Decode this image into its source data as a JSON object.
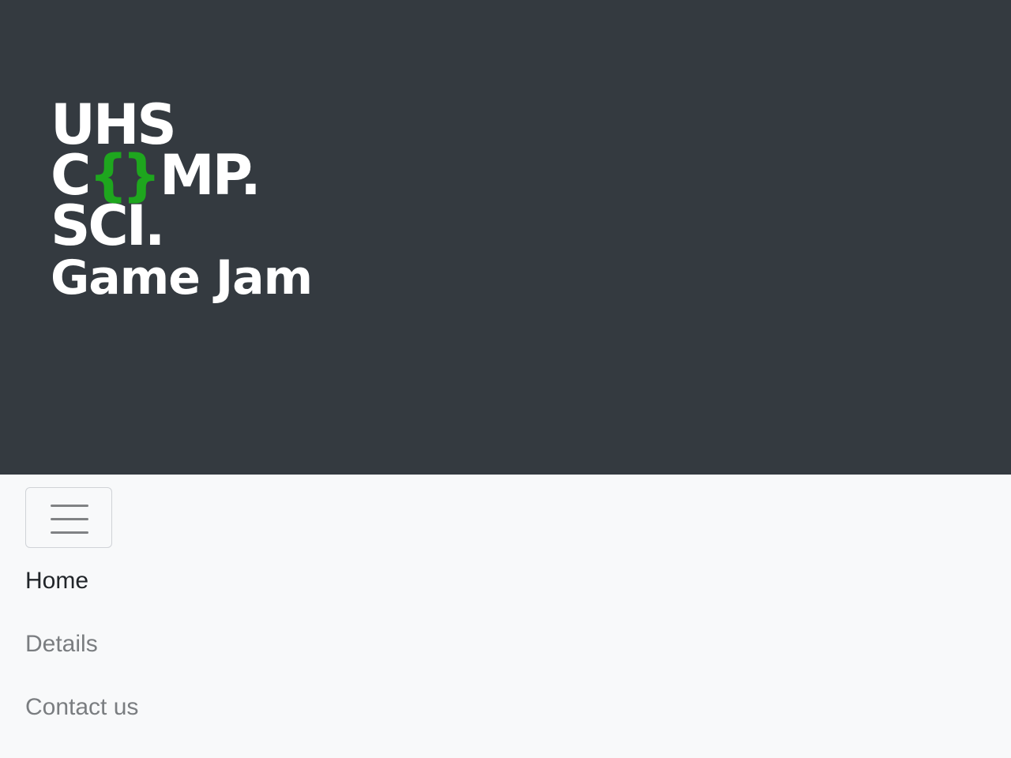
{
  "colors": {
    "hero_background": "#343a40",
    "logo_text": "#ffffff",
    "logo_accent": "#1ea61e",
    "nav_background": "#f8f9fa",
    "nav_active": "#212529",
    "nav_inactive": "#7a7d80",
    "toggler_bar": "#808284"
  },
  "logo": {
    "line1": "UHS",
    "line2_prefix": "C",
    "line2_braces": "{}",
    "line2_suffix": "MP.",
    "line3": "SCI.",
    "line4": "Game Jam"
  },
  "navbar": {
    "toggler_icon": "hamburger-icon",
    "links": [
      {
        "label": "Home",
        "active": true
      },
      {
        "label": "Details",
        "active": false
      },
      {
        "label": "Contact us",
        "active": false
      }
    ]
  }
}
